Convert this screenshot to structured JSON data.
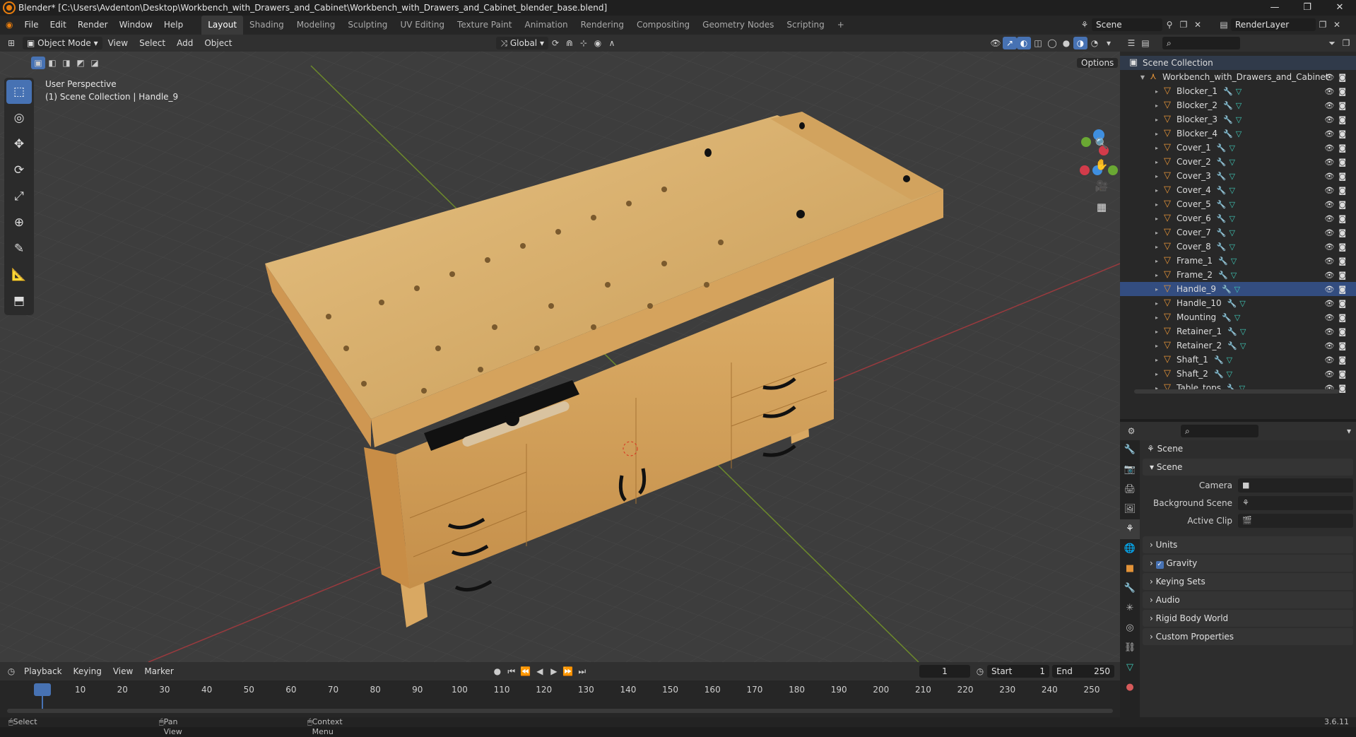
{
  "window": {
    "title": "Blender* [C:\\Users\\Avdenton\\Desktop\\Workbench_with_Drawers_and_Cabinet\\Workbench_with_Drawers_and_Cabinet_blender_base.blend]"
  },
  "menu": [
    "File",
    "Edit",
    "Render",
    "Window",
    "Help"
  ],
  "workspaces": [
    "Layout",
    "Shading",
    "Modeling",
    "Sculpting",
    "UV Editing",
    "Texture Paint",
    "Animation",
    "Rendering",
    "Compositing",
    "Geometry Nodes",
    "Scripting"
  ],
  "active_workspace": "Layout",
  "scene_name": "Scene",
  "view_layer": "RenderLayer",
  "viewport_header": {
    "mode": "Object Mode",
    "view": "View",
    "select": "Select",
    "add": "Add",
    "object": "Object",
    "orientation": "Global",
    "options": "Options"
  },
  "viewport_info": {
    "line1": "User Perspective",
    "line2": "(1) Scene Collection | Handle_9"
  },
  "outliner": {
    "root": "Scene Collection",
    "collection": "Workbench_with_Drawers_and_Cabinet",
    "items": [
      "Blocker_1",
      "Blocker_2",
      "Blocker_3",
      "Blocker_4",
      "Cover_1",
      "Cover_2",
      "Cover_3",
      "Cover_4",
      "Cover_5",
      "Cover_6",
      "Cover_7",
      "Cover_8",
      "Frame_1",
      "Frame_2",
      "Handle_9",
      "Handle_10",
      "Mounting",
      "Retainer_1",
      "Retainer_2",
      "Shaft_1",
      "Shaft_2",
      "Table_tops"
    ],
    "selected": "Handle_9"
  },
  "properties": {
    "context": "Scene",
    "panel": "Scene",
    "camera_label": "Camera",
    "bg_scene_label": "Background Scene",
    "active_clip_label": "Active Clip",
    "sections": [
      "Units",
      "Gravity",
      "Keying Sets",
      "Audio",
      "Rigid Body World",
      "Custom Properties"
    ],
    "gravity_checked": true
  },
  "timeline": {
    "menus": [
      "Playback",
      "Keying",
      "View",
      "Marker"
    ],
    "current_frame": "1",
    "start_label": "Start",
    "start": "1",
    "end_label": "End",
    "end": "250",
    "ticks": [
      "1",
      "10",
      "20",
      "30",
      "40",
      "50",
      "60",
      "70",
      "80",
      "90",
      "100",
      "110",
      "120",
      "130",
      "140",
      "150",
      "160",
      "170",
      "180",
      "190",
      "200",
      "210",
      "220",
      "230",
      "240",
      "250"
    ]
  },
  "statusbar": {
    "select": "Select",
    "pan": "Pan View",
    "context": "Context Menu",
    "version": "3.6.11"
  }
}
